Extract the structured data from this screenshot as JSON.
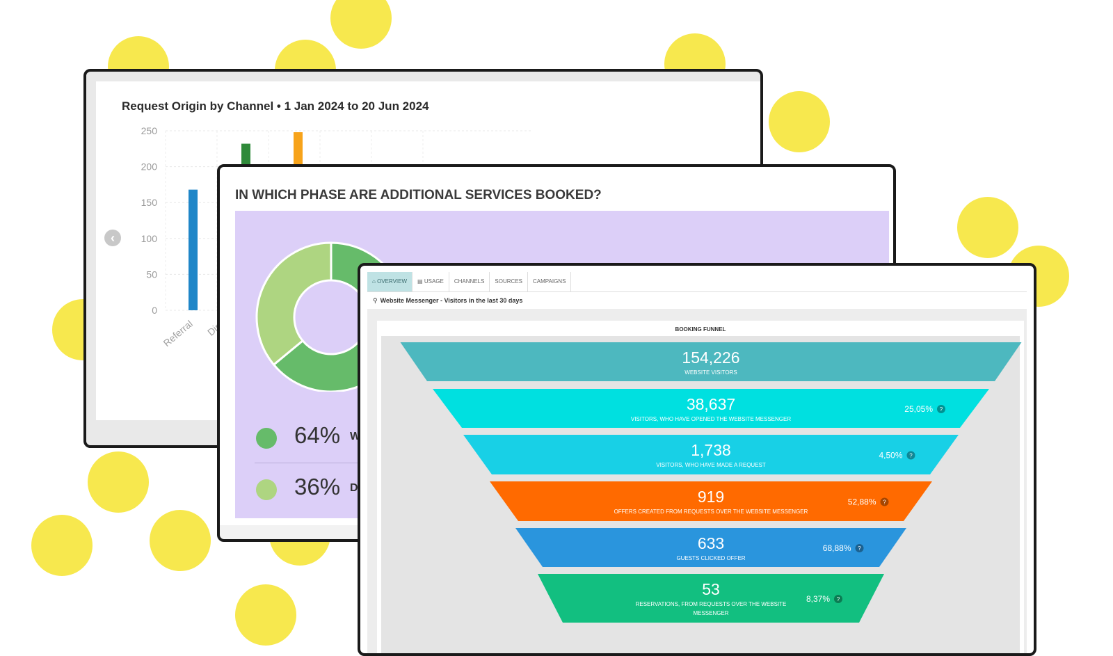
{
  "colors": {
    "dots": "#f7e84e",
    "panel_purple": "#dccff8"
  },
  "card1": {
    "title": "Request Origin by Channel • 1 Jan 2024 to 20 Jun 2024",
    "back_icon": "chevron-left-icon",
    "chart_data": {
      "type": "bar",
      "title": "Request Origin by Channel • 1 Jan 2024 to 20 Jun 2024",
      "categories": [
        "Referral",
        "Dire"
      ],
      "visible_bars": [
        {
          "category": "Referral",
          "value": 168,
          "color": "#1f86c8"
        },
        {
          "category": "",
          "value": 232,
          "color": "#2f8a3a"
        },
        {
          "category": "",
          "value": 248,
          "color": "#f7a31a"
        }
      ],
      "yticks": [
        "250",
        "200",
        "150",
        "100",
        "50",
        "0"
      ],
      "ylim": [
        0,
        250
      ],
      "grid": true
    }
  },
  "card2": {
    "title": "IN WHICH PHASE ARE ADDITIONAL SERVICES BOOKED?",
    "chart_data": {
      "type": "pie",
      "slices": [
        {
          "label": "W",
          "value": 64,
          "color": "#66bb6a"
        },
        {
          "label": "DI",
          "value": 36,
          "color": "#aed581"
        }
      ]
    },
    "legend": [
      {
        "pct": "64%",
        "label": "W",
        "color": "#66bb6a"
      },
      {
        "pct": "36%",
        "label": "DI",
        "color": "#aed581"
      }
    ]
  },
  "card3": {
    "tabs": [
      {
        "label": "Overview",
        "icon": "home-icon",
        "active": true
      },
      {
        "label": "Usage",
        "icon": "chart-icon",
        "active": false
      },
      {
        "label": "Channels",
        "active": false
      },
      {
        "label": "Sources",
        "active": false
      },
      {
        "label": "Campaigns",
        "active": false
      }
    ],
    "subtitle": "Website Messenger - Visitors in the last 30 days",
    "subtitle_icon": "search-icon",
    "funnel_title": "BOOKING FUNNEL",
    "chart_data": {
      "type": "funnel",
      "stages": [
        {
          "value": "154,226",
          "label": "WEBSITE VISITORS",
          "pct": "",
          "color": "#4db8bf"
        },
        {
          "value": "38,637",
          "label": "VISITORS, WHO HAVE OPENED THE WEBSITE MESSENGER",
          "pct": "25,05%",
          "color": "#00e0e0"
        },
        {
          "value": "1,738",
          "label": "VISITORS, WHO HAVE MADE A REQUEST",
          "pct": "4,50%",
          "color": "#18d0e6"
        },
        {
          "value": "919",
          "label": "OFFERS CREATED FROM REQUESTS OVER THE WEBSITE MESSENGER",
          "pct": "52,88%",
          "color": "#ff6a00"
        },
        {
          "value": "633",
          "label": "GUESTS CLICKED OFFER",
          "pct": "68,88%",
          "color": "#2a95dd"
        },
        {
          "value": "53",
          "label": "RESERVATIONS, FROM REQUESTS OVER THE WEBSITE MESSENGER",
          "pct": "8,37%",
          "color": "#12bf80"
        }
      ]
    }
  }
}
